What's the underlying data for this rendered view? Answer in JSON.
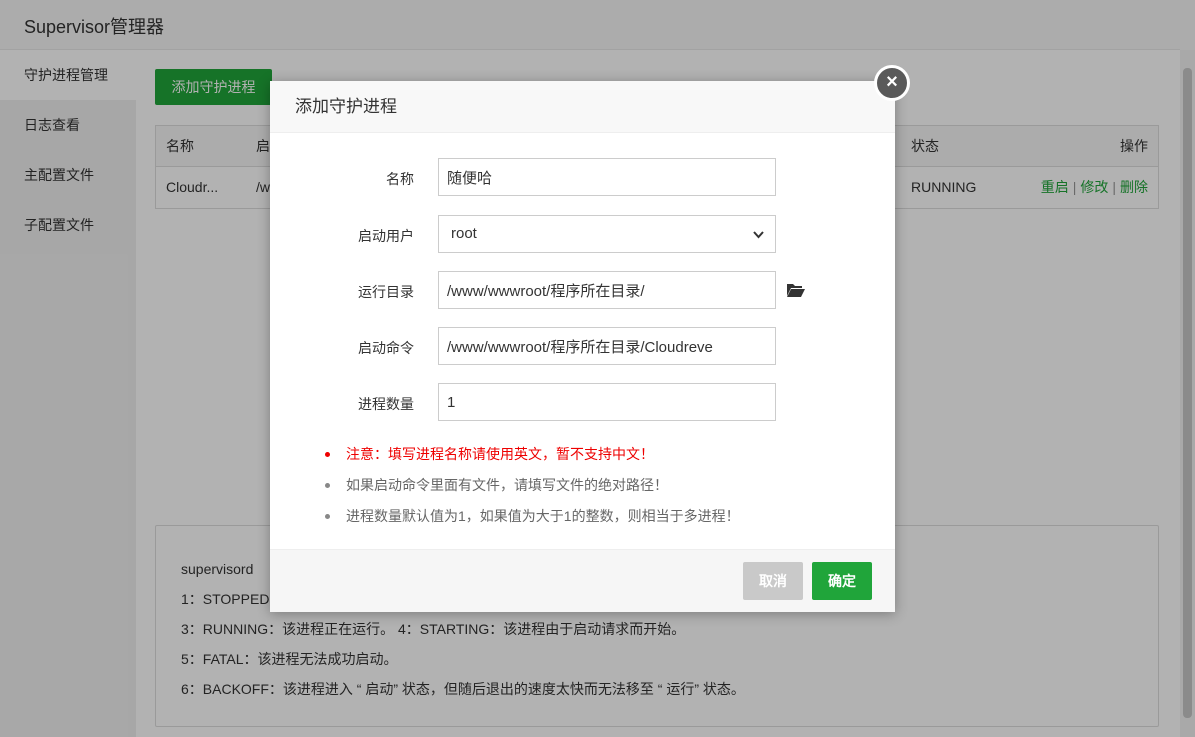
{
  "app": {
    "title": "Supervisor管理器",
    "sidebar": [
      "守护进程管理",
      "日志查看",
      "主配置文件",
      "子配置文件"
    ],
    "add_button": "添加守护进程",
    "table": {
      "headers": [
        "名称",
        "启",
        "状态",
        "操作"
      ],
      "row": {
        "name": "Cloudr...",
        "cmd": "/w",
        "status": "RUNNING"
      },
      "actions": [
        "重启",
        "修改",
        "删除"
      ]
    },
    "info_lines": [
      "supervisord",
      "1：STOPPED",
      "3：RUNNING：该进程正在运行。 4：STARTING：该进程由于启动请求而开始。",
      "5：FATAL：该进程无法成功启动。",
      "6：BACKOFF：该进程进入 “ 启动” 状态，但随后退出的速度太快而无法移至 “ 运行” 状态。"
    ]
  },
  "modal": {
    "title": "添加守护进程",
    "fields": {
      "name": {
        "label": "名称",
        "value": "随便哈"
      },
      "user": {
        "label": "启动用户",
        "value": "root"
      },
      "dir": {
        "label": "运行目录",
        "value": "/www/wwwroot/程序所在目录/"
      },
      "cmd": {
        "label": "启动命令",
        "value": "/www/wwwroot/程序所在目录/Cloudreve"
      },
      "count": {
        "label": "进程数量",
        "value": "1"
      }
    },
    "notes": [
      "注意：填写进程名称请使用英文，暂不支持中文！",
      "如果启动命令里面有文件，请填写文件的绝对路径！",
      "进程数量默认值为1，如果值为大于1的整数，则相当于多进程！"
    ],
    "cancel": "取消",
    "ok": "确定",
    "close_symbol": "×"
  },
  "colors": {
    "accent": "#20a53a",
    "warning": "#e00000"
  }
}
